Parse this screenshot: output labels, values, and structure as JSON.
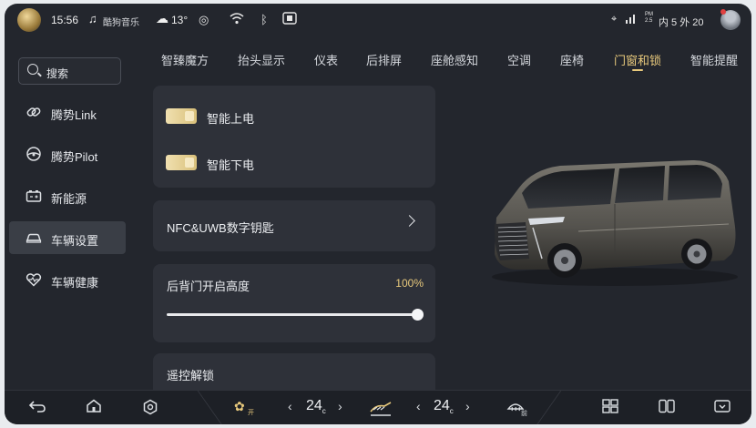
{
  "status_bar": {
    "time": "15:56",
    "music_label": "酷狗音乐",
    "temperature": "13°",
    "right_pm": "PM 2.5",
    "right_info": "内 5 外 20",
    "icons": [
      "brand-logo-icon",
      "music-note-icon",
      "weather-cloud-icon",
      "hotspot-icon",
      "wifi-icon",
      "bluetooth-icon",
      "screen-icon",
      "location-icon",
      "signal-icon",
      "avatar"
    ]
  },
  "sidebar": {
    "search_label": "搜索",
    "items": [
      {
        "label": "腾势Link",
        "icon": "link-icon"
      },
      {
        "label": "腾势Pilot",
        "icon": "steering-icon"
      },
      {
        "label": "新能源",
        "icon": "battery-icon"
      },
      {
        "label": "车辆设置",
        "icon": "car-icon",
        "active": true
      },
      {
        "label": "车辆健康",
        "icon": "heart-icon"
      }
    ]
  },
  "tabs": [
    {
      "label": "智臻魔方"
    },
    {
      "label": "抬头显示"
    },
    {
      "label": "仪表"
    },
    {
      "label": "后排屏"
    },
    {
      "label": "座舱感知"
    },
    {
      "label": "空调"
    },
    {
      "label": "座椅"
    },
    {
      "label": "门窗和锁",
      "active": true
    },
    {
      "label": "智能提醒"
    }
  ],
  "settings": {
    "smart_power_on": {
      "label": "智能上电",
      "enabled": true
    },
    "smart_power_off": {
      "label": "智能下电",
      "enabled": true
    },
    "nfc_key_label": "NFC&UWB数字钥匙",
    "tailgate": {
      "label": "后背门开启高度",
      "value_text": "100%",
      "value": 1.0
    },
    "remote_unlock_label": "遥控解锁"
  },
  "bottom_bar": {
    "fan_label": "开",
    "left_temp": "24",
    "right_temp": "24",
    "temp_unit": "c",
    "defrost_label": "前",
    "accent_color": "#e8c97c"
  }
}
